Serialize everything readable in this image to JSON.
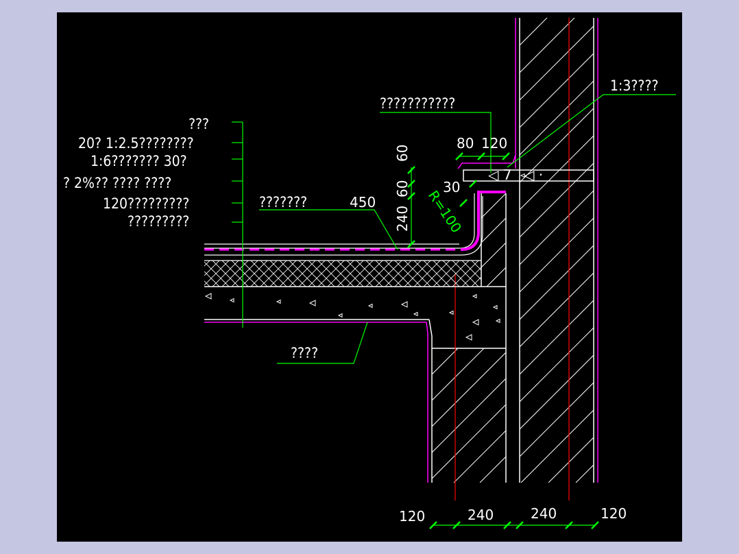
{
  "colors": {
    "background": "#c4c6e2",
    "canvas": "#000000",
    "structure": "#ffffff",
    "leader": "#00ff00",
    "membrane": "#ff00ff",
    "axis": "#ff0000"
  },
  "labels": {
    "layer1": "???",
    "layer2": "20? 1:2.5????????",
    "layer3": "1:6???????   30?",
    "layer4": "? 2%?? ????  ????",
    "layer5": "120?????????",
    "layer6": "?????????",
    "membrane": "???????",
    "membrane_len": "450",
    "flashing": "???????????",
    "mortar": "1:3????",
    "slab": "????"
  },
  "dims": {
    "h60a": "60",
    "h60b": "60",
    "h240": "240",
    "d80": "80",
    "d120": "120",
    "d30": "30",
    "radius": "R=100",
    "b120l": "120",
    "b240a": "240",
    "b240b": "240",
    "b120r": "120"
  }
}
